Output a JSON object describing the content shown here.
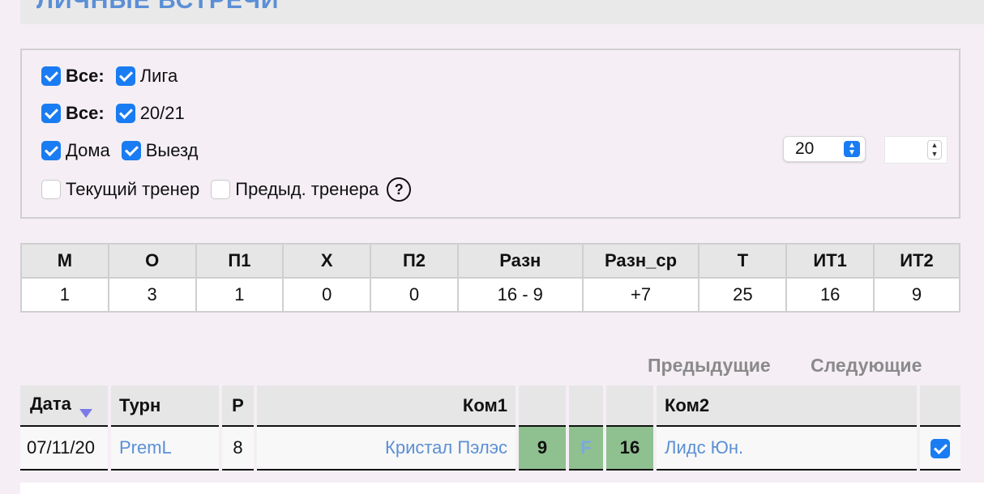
{
  "section_title": "ЛИЧНЫЕ ВСТРЕЧИ",
  "filters": {
    "row1": {
      "all_label": "Все:",
      "all_checked": true,
      "option_label": "Лига",
      "option_checked": true
    },
    "row2": {
      "all_label": "Все:",
      "all_checked": true,
      "option_label": "20/21",
      "option_checked": true
    },
    "row3": {
      "home_label": "Дома",
      "home_checked": true,
      "away_label": "Выезд",
      "away_checked": true
    },
    "row4": {
      "current_coach_label": "Текущий тренер",
      "current_coach_checked": false,
      "prev_coach_label": "Предыд. тренера",
      "prev_coach_checked": false,
      "help_label": "?"
    },
    "count_select_value": "20",
    "number_input_value": ""
  },
  "stats": {
    "headers": [
      "М",
      "О",
      "П1",
      "Х",
      "П2",
      "Разн",
      "Разн_ср",
      "Т",
      "ИТ1",
      "ИТ2"
    ],
    "values": [
      "1",
      "3",
      "1",
      "0",
      "0",
      "16 - 9",
      "+7",
      "25",
      "16",
      "9"
    ]
  },
  "pager": {
    "prev_label": "Предыдущие",
    "next_label": "Следующие"
  },
  "matches": {
    "headers": {
      "date": "Дата",
      "tournament": "Турн",
      "round": "Р",
      "team1": "Ком1",
      "team2": "Ком2"
    },
    "rows": [
      {
        "date": "07/11/20",
        "tournament": "PremL",
        "round": "8",
        "team1": "Кристал Пэлэс",
        "score1": "9",
        "status": "F",
        "score2": "16",
        "team2": "Лидс Юн.",
        "selected": true
      }
    ]
  },
  "colors": {
    "accent": "#1a7cf2",
    "link": "#5b8fd6",
    "score_bg": "#8fc08f",
    "pager": "#8a8a8a"
  }
}
